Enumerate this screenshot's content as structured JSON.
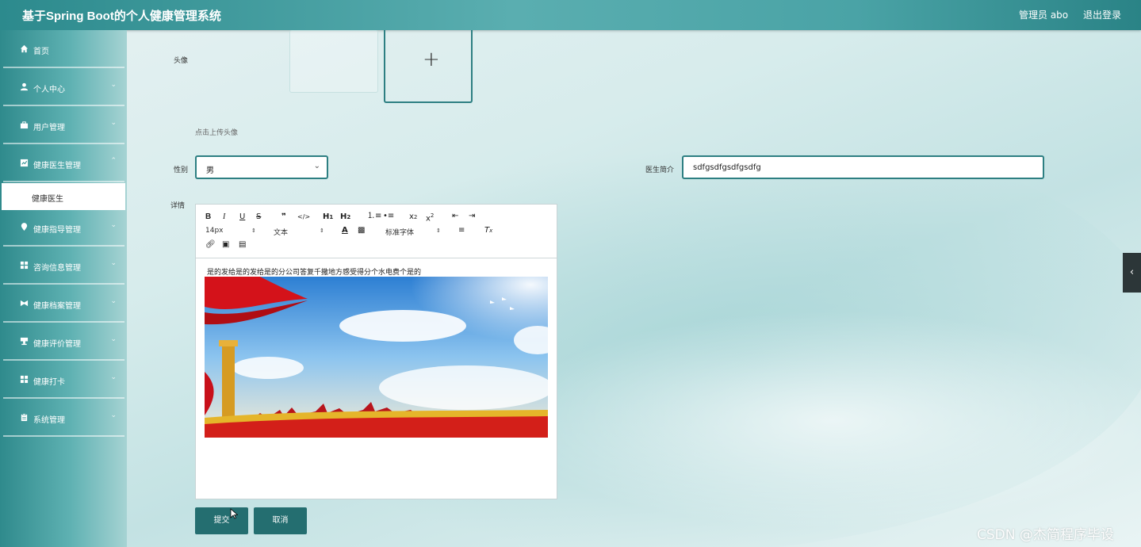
{
  "header": {
    "title": "基于Spring Boot的个人健康管理系统",
    "user": "管理员 abo",
    "logout": "退出登录"
  },
  "sidebar": {
    "items": [
      {
        "label": "首页",
        "icon": "home-icon"
      },
      {
        "label": "个人中心",
        "icon": "user-icon"
      },
      {
        "label": "用户管理",
        "icon": "briefcase-icon"
      },
      {
        "label": "健康医生管理",
        "icon": "chart-icon"
      },
      {
        "label": "健康指导管理",
        "icon": "location-icon"
      },
      {
        "label": "咨询信息管理",
        "icon": "grid-icon"
      },
      {
        "label": "健康档案管理",
        "icon": "bowtie-icon"
      },
      {
        "label": "健康评价管理",
        "icon": "cup-icon"
      },
      {
        "label": "健康打卡",
        "icon": "grid-icon"
      },
      {
        "label": "系统管理",
        "icon": "clipboard-icon"
      }
    ],
    "active_sub": "健康医生"
  },
  "form": {
    "avatar_label": "头像",
    "avatar_tip": "点击上传头像",
    "gender_label": "性别",
    "gender_value": "男",
    "intro_label": "医生简介",
    "intro_value": "sdfgsdfgsdfgsdfg",
    "detail_label": "详情",
    "submit": "提交",
    "cancel": "取消"
  },
  "editor": {
    "font_size": "14px",
    "heading": "文本",
    "font_family": "标准字体",
    "content_text": "是的发给是的发给是的分公司答复千撒地方感受得分个水电费个是的"
  },
  "watermark": "CSDN @杰简程序毕设"
}
